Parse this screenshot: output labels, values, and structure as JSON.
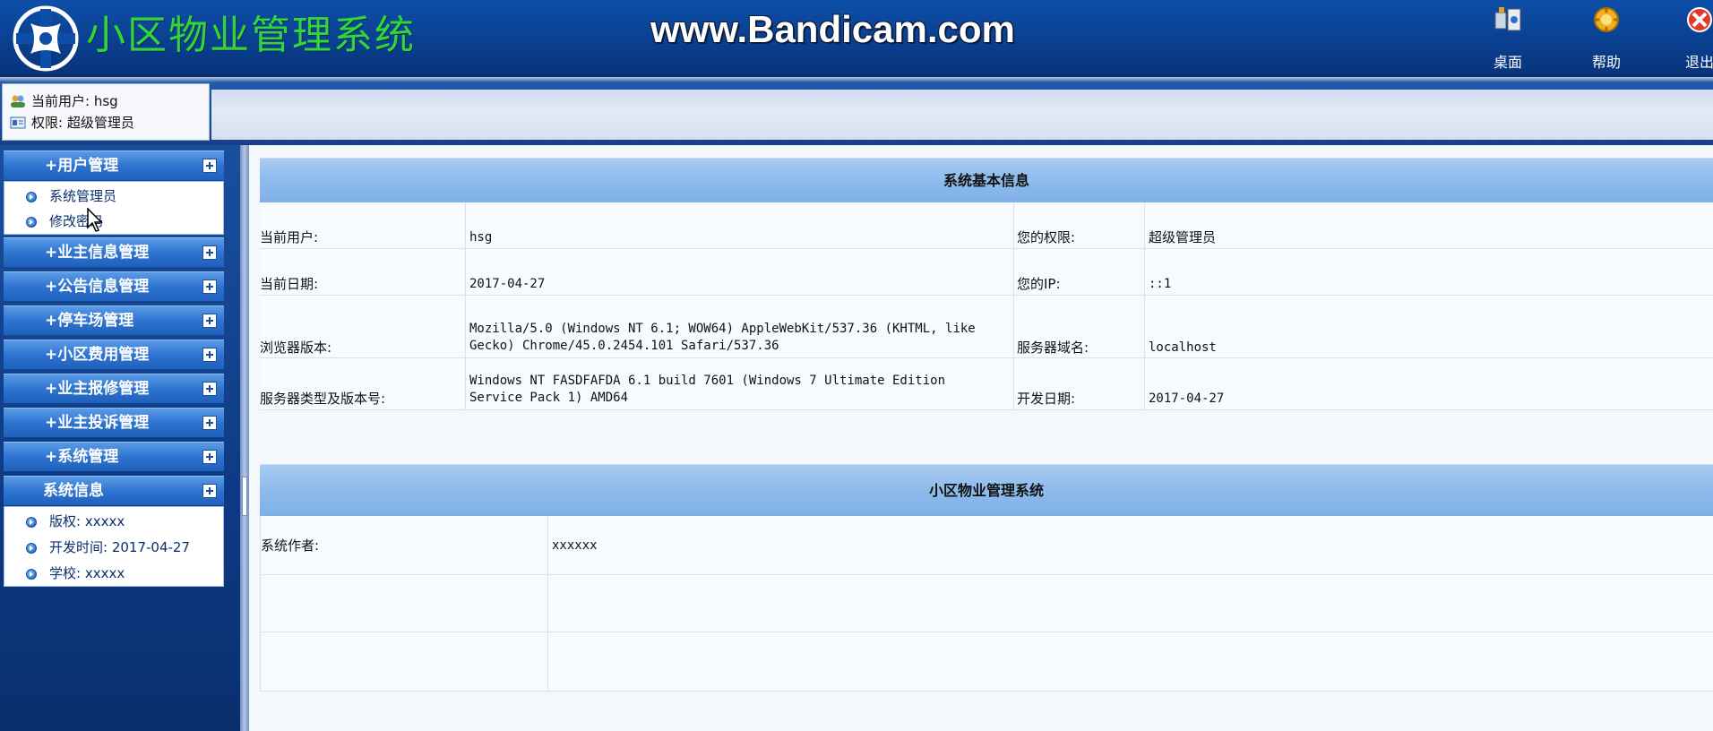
{
  "header": {
    "title": "小区物业管理系统",
    "watermark": "www.Bandicam.com",
    "buttons": [
      {
        "label": "桌面",
        "icon": "desktop-icon"
      },
      {
        "label": "帮助",
        "icon": "help-icon"
      },
      {
        "label": "退出",
        "icon": "exit-icon"
      }
    ]
  },
  "user": {
    "current_user": "当前用户: hsg",
    "permission": "权限: 超级管理员"
  },
  "sidebar": {
    "user_mgmt": {
      "label": "+用户管理",
      "items": [
        "系统管理员",
        "修改密码"
      ]
    },
    "owner_info": "+业主信息管理",
    "notice": "+公告信息管理",
    "parking": "+停车场管理",
    "fees": "+小区费用管理",
    "repair": "+业主报修管理",
    "complaint": "+业主投诉管理",
    "system": "+系统管理",
    "sysinfo": {
      "label": "系统信息",
      "items": [
        "版权: xxxxx",
        "开发时间: 2017-04-27",
        "学校: xxxxx"
      ]
    }
  },
  "basic_info": {
    "heading": "系统基本信息",
    "current_user_label": "当前用户:",
    "current_user_value": "hsg",
    "permission_label": "您的权限:",
    "permission_value": "超级管理员",
    "date_label": "当前日期:",
    "date_value": "2017-04-27",
    "ip_label": "您的IP:",
    "ip_value": "::1",
    "browser_label": "浏览器版本:",
    "browser_value": "Mozilla/5.0 (Windows NT 6.1; WOW64) AppleWebKit/537.36 (KHTML, like Gecko) Chrome/45.0.2454.101 Safari/537.36",
    "domain_label": "服务器域名:",
    "domain_value": "localhost",
    "server_label": "服务器类型及版本号:",
    "server_value": "Windows NT FASDFAFDA 6.1 build 7601 (Windows 7 Ultimate Edition Service Pack 1) AMD64",
    "dev_date_label": "开发日期:",
    "dev_date_value": "2017-04-27"
  },
  "system_section": {
    "heading": "小区物业管理系统",
    "author_label": "系统作者:",
    "author_value": "xxxxxx"
  }
}
